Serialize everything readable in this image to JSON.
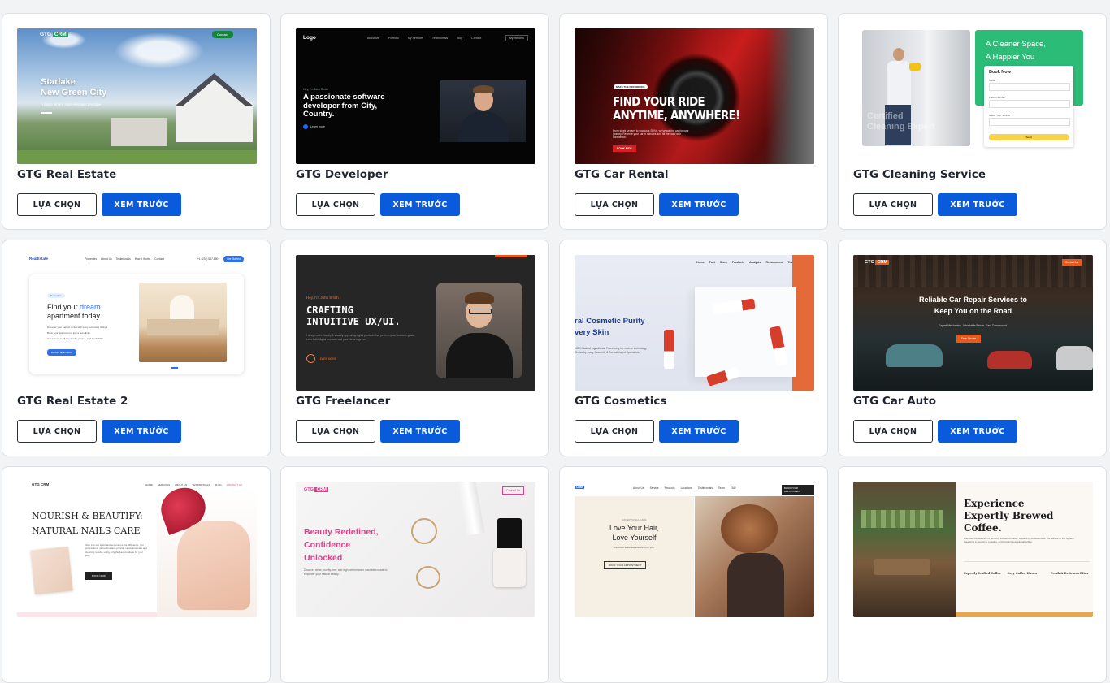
{
  "buttons": {
    "choose": "LỰA CHỌN",
    "preview": "XEM TRƯỚC"
  },
  "cards": [
    {
      "title": "GTG Real Estate",
      "thumb": {
        "brand": "GTG",
        "badge": "CRM",
        "contact": "Contact",
        "headline1": "Starlake",
        "headline2": "New Green City",
        "sub": "A place where style elevates prestige"
      }
    },
    {
      "title": "GTG Developer",
      "thumb": {
        "logo": "Logo",
        "nav": [
          "About Me",
          "Portfolio",
          "My Services",
          "Testimonials",
          "Blog",
          "Contact"
        ],
        "search": "My Reports",
        "kicker": "Hey, I'm John Smith",
        "headline": "A passionate software developer from City, Country.",
        "cta": "Learn more"
      }
    },
    {
      "title": "GTG Car Rental",
      "thumb": {
        "pill": "MAKE THE DIFFERENCE",
        "headline1": "FIND YOUR RIDE",
        "headline2": "ANYTIME, ANYWHERE!",
        "body": "From sleek sedans to spacious SUVs, we've got the car for your journey. Reserve your car in minutes and hit the road with confidence.",
        "cta": "BOOK RIDE"
      }
    },
    {
      "title": "GTG Cleaning Service",
      "thumb": {
        "headline1": "A Cleaner Space,",
        "headline2": "A Happier You",
        "form_title": "Book Now",
        "f1": "Name",
        "f2": "Phone Number*",
        "f3": "Select Your Service*",
        "send": "Send",
        "ghost1": "Certified",
        "ghost2": "Cleaning Expert"
      }
    },
    {
      "title": "GTG Real Estate 2",
      "thumb": {
        "logo": "RealEstate",
        "nav": [
          "Properties",
          "About Us",
          "Testimonials",
          "How It Works",
          "Contact"
        ],
        "phone": "+1 (234) 567-890",
        "cta_top": "Get Started",
        "pill": "Book Now",
        "headline1": "Find your",
        "highlight": "dream",
        "headline2": "apartment today",
        "b1": "Discover your perfect rental with easy-to-browse listings",
        "b2": "Book your apartment in just a few clicks",
        "b3": "Get access to all the details, photos, and availability",
        "cta": "Explore apartments"
      }
    },
    {
      "title": "GTG Freelancer",
      "thumb": {
        "kicker": "Hey, I'm John Smith",
        "headline1": "CRAFTING",
        "headline2": "INTUITIVE UX/UI.",
        "body": "I design user-friendly & visually appealing digital products that perform your business goals. Let's build digital products and your ideas together.",
        "cta": "LEARN MORE"
      }
    },
    {
      "title": "GTG Cosmetics",
      "thumb": {
        "nav": [
          "Home",
          "Fact",
          "Story",
          "Products",
          "Analysis",
          "Recommend",
          "Testimonial"
        ],
        "headline1": "ral Cosmetic Purity",
        "headline2": "very Skin",
        "body": "100% Natural Ingredients. Processing by modern technology. Choice by many Cosmetic & Dermatologist Specialists."
      }
    },
    {
      "title": "GTG Car Auto",
      "thumb": {
        "brand": "GTG",
        "badge": "CRM",
        "contact": "Contact Us",
        "headline1": "Reliable Car Repair Services to",
        "headline2": "Keep You on the Road",
        "sub": "Expert Mechanics. Affordable Prices. Fast Turnaround.",
        "cta": "Free Quotes"
      }
    },
    {
      "title": "",
      "thumb": {
        "brand": "GTG CRM",
        "nav": [
          "HOME",
          "SERVICES",
          "ABOUT US",
          "TESTIMONIALS",
          "BLOG",
          "CONTACT US"
        ],
        "headline1": "NOURISH & BEAUTIFY:",
        "headline2": "NATURAL NAILS CARE",
        "body": "Step into our salon and experience the difference. Our professional nail technicians provide meticulous care and stunning results, using only the best products for your skin.",
        "cta": "BOOK NOW"
      }
    },
    {
      "title": "",
      "thumb": {
        "brand": "GTG",
        "badge": "CRM",
        "contact": "Contact Us",
        "headline1": "Beauty Redefined,",
        "headline2": "Confidence",
        "headline3": "Unlocked",
        "body": "Discover clean, cruelty-free, and high-performance cosmetics made to empower your natural beauty."
      }
    },
    {
      "title": "",
      "thumb": {
        "brand": "CRM",
        "nav": [
          "About Us",
          "Service",
          "Products",
          "Locations",
          "Testimonials",
          "Team",
          "FAQ"
        ],
        "cta_top": "BOOK YOUR APPOINTMENT",
        "kicker": "EXCEPTIONAL CARE",
        "headline1": "Love Your Hair,",
        "headline2": "Love Yourself",
        "sub": "Discover salon experience fit for you",
        "cta": "BOOK YOUR APPOINTMENT"
      }
    },
    {
      "title": "",
      "thumb": {
        "headline1": "Experience",
        "headline2": "Expertly Brewed",
        "headline3": "Coffee.",
        "body": "Discover the essence of perfectly extracted coffee, brewed by professionals. We adhere to the highest standards in sourcing, roasting, and brewing exceptional coffee.",
        "c1": "Expertly Crafted Coffee",
        "c2": "Cozy Coffee Haven",
        "c3": "Fresh & Delicious Bites"
      }
    }
  ],
  "colors": {
    "primary": "#0a5bdc",
    "border": "#dcdfe4",
    "title": "#1f2430"
  }
}
